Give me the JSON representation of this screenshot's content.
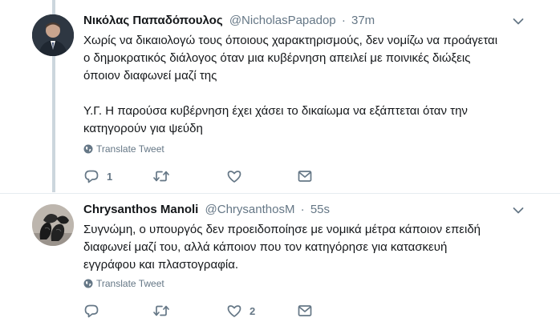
{
  "tweets": [
    {
      "name": "Νικόλας Παπαδόπουλος",
      "handle": "@NicholasPapadop",
      "separator": "·",
      "time": "37m",
      "text_lines": [
        "Χωρίς να δικαιολογώ τους όποιους χαρακτηρισμούς, δεν νομίζω να προάγεται",
        "ο δημοκρατικός διάλογος όταν μια κυβέρνηση απειλεί με ποινικές διώξεις",
        "όποιον διαφωνεί μαζί της",
        "",
        "Υ.Γ. Η παρούσα κυβέρνηση έχει χάσει το δικαίωμα να εξάπτεται όταν την",
        "κατηγορούν για ψεύδη"
      ],
      "translate_label": "Translate Tweet",
      "reply_count": "1",
      "retweet_count": "",
      "like_count": ""
    },
    {
      "name": "Chrysanthos Manoli",
      "handle": "@ChrysanthosM",
      "separator": "·",
      "time": "55s",
      "text_lines": [
        "Συγνώμη, ο υπουργός δεν προειδοποίησε με νομικά μέτρα κάποιον επειδή",
        "διαφωνεί μαζί του, αλλά κάποιον που τον κατηγόρησε για κατασκευή",
        "εγγράφου και πλαστογραφία."
      ],
      "translate_label": "Translate Tweet",
      "reply_count": "",
      "retweet_count": "",
      "like_count": "2"
    }
  ],
  "icons": {
    "caret": "chevron-down-icon",
    "translate": "globe-icon",
    "reply": "reply-icon",
    "retweet": "retweet-icon",
    "like": "heart-icon",
    "dm": "envelope-icon"
  },
  "colors": {
    "text": "#14171a",
    "secondary": "#657786",
    "thread_line": "#ccd6dd",
    "divider": "#e6ecf0"
  }
}
